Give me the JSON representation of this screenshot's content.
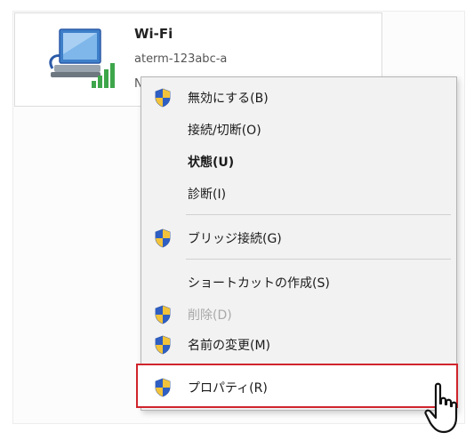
{
  "adapter": {
    "name": "Wi-Fi",
    "ssid": "aterm-123abc-a",
    "extra": "N",
    "icon": "network-adapter-icon"
  },
  "menu": {
    "items": [
      {
        "label": "無効にする(B)",
        "shield": true,
        "style": "normal"
      },
      {
        "label": "接続/切断(O)",
        "shield": false,
        "style": "normal"
      },
      {
        "label": "状態(U)",
        "shield": false,
        "style": "bold"
      },
      {
        "label": "診断(I)",
        "shield": false,
        "style": "normal"
      },
      {
        "label": "ブリッジ接続(G)",
        "shield": true,
        "style": "normal"
      },
      {
        "label": "ショートカットの作成(S)",
        "shield": false,
        "style": "normal"
      },
      {
        "label": "削除(D)",
        "shield": true,
        "style": "disabled"
      },
      {
        "label": "名前の変更(M)",
        "shield": true,
        "style": "normal"
      },
      {
        "label": "プロパティ(R)",
        "shield": true,
        "style": "highlighted"
      }
    ]
  },
  "colors": {
    "highlight_border": "#d0242c",
    "menu_bg": "#f2f2f2",
    "disabled_text": "#a9a9a9"
  },
  "cursor": "hand-pointer-icon"
}
